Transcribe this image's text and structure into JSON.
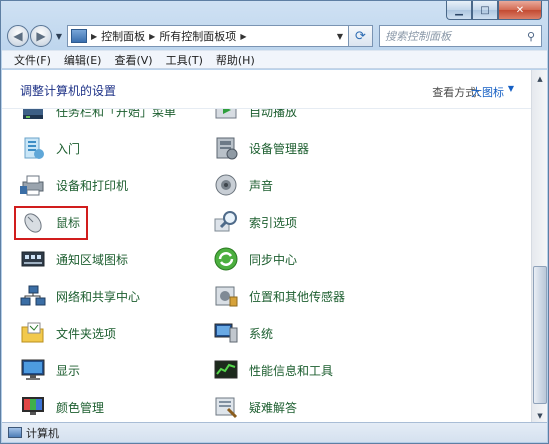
{
  "address": {
    "crumbs": [
      "控制面板",
      "所有控制面板项"
    ],
    "search_placeholder": "搜索控制面板"
  },
  "menu": [
    "文件(F)",
    "编辑(E)",
    "查看(V)",
    "工具(T)",
    "帮助(H)"
  ],
  "content": {
    "heading": "调整计算机的设置",
    "view_by_label": "查看方式:",
    "view_by_value": "大图标",
    "left_items": [
      {
        "label": "任务栏和「开始」菜单",
        "icon": "taskbar-icon"
      },
      {
        "label": "入门",
        "icon": "getting-started-icon"
      },
      {
        "label": "设备和打印机",
        "icon": "printer-icon"
      },
      {
        "label": "鼠标",
        "icon": "mouse-icon"
      },
      {
        "label": "通知区域图标",
        "icon": "notification-icon"
      },
      {
        "label": "网络和共享中心",
        "icon": "network-icon"
      },
      {
        "label": "文件夹选项",
        "icon": "folder-icon"
      },
      {
        "label": "显示",
        "icon": "display-icon"
      },
      {
        "label": "颜色管理",
        "icon": "color-icon"
      }
    ],
    "right_items": [
      {
        "label": "自动播放",
        "icon": "autoplay-icon"
      },
      {
        "label": "设备管理器",
        "icon": "device-manager-icon"
      },
      {
        "label": "声音",
        "icon": "sound-icon"
      },
      {
        "label": "索引选项",
        "icon": "index-icon"
      },
      {
        "label": "同步中心",
        "icon": "sync-icon"
      },
      {
        "label": "位置和其他传感器",
        "icon": "sensor-icon"
      },
      {
        "label": "系统",
        "icon": "system-icon"
      },
      {
        "label": "性能信息和工具",
        "icon": "performance-icon"
      },
      {
        "label": "疑难解答",
        "icon": "troubleshoot-icon"
      }
    ]
  },
  "status": {
    "text": "计算机"
  },
  "colors": {
    "highlight": "#d11d1d",
    "link_green": "#1c5e2f",
    "heading_blue": "#1e3287"
  }
}
